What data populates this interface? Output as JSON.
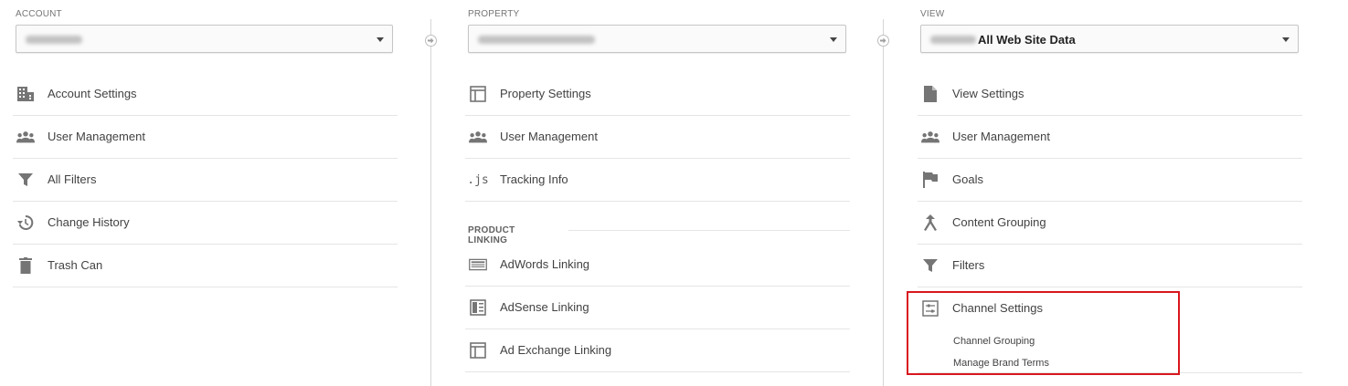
{
  "account": {
    "label": "ACCOUNT",
    "items": [
      {
        "label": "Account Settings",
        "icon": "building-icon"
      },
      {
        "label": "User Management",
        "icon": "people-icon"
      },
      {
        "label": "All Filters",
        "icon": "filter-icon"
      },
      {
        "label": "Change History",
        "icon": "history-icon"
      },
      {
        "label": "Trash Can",
        "icon": "trash-icon"
      }
    ]
  },
  "property": {
    "label": "PROPERTY",
    "items": [
      {
        "label": "Property Settings",
        "icon": "square-layout-icon"
      },
      {
        "label": "User Management",
        "icon": "people-icon"
      },
      {
        "label": "Tracking Info",
        "icon": "js-icon",
        "glyph": ".js"
      }
    ],
    "section_title": "PRODUCT LINKING",
    "linking_items": [
      {
        "label": "AdWords Linking",
        "icon": "adwords-icon"
      },
      {
        "label": "AdSense Linking",
        "icon": "adsense-icon"
      },
      {
        "label": "Ad Exchange Linking",
        "icon": "ad-exchange-icon"
      }
    ]
  },
  "view": {
    "label": "VIEW",
    "selected_suffix": "All Web Site Data",
    "items": [
      {
        "label": "View Settings",
        "icon": "document-icon"
      },
      {
        "label": "User Management",
        "icon": "people-icon"
      },
      {
        "label": "Goals",
        "icon": "flag-icon"
      },
      {
        "label": "Content Grouping",
        "icon": "content-grouping-icon"
      },
      {
        "label": "Filters",
        "icon": "filter-icon"
      },
      {
        "label": "Channel Settings",
        "icon": "channel-settings-icon"
      }
    ],
    "sub_items": [
      {
        "label": "Channel Grouping"
      },
      {
        "label": "Manage Brand Terms"
      }
    ]
  },
  "colors": {
    "highlight": "#d9161d",
    "icon": "#616161",
    "divider": "#e5e5e5"
  }
}
